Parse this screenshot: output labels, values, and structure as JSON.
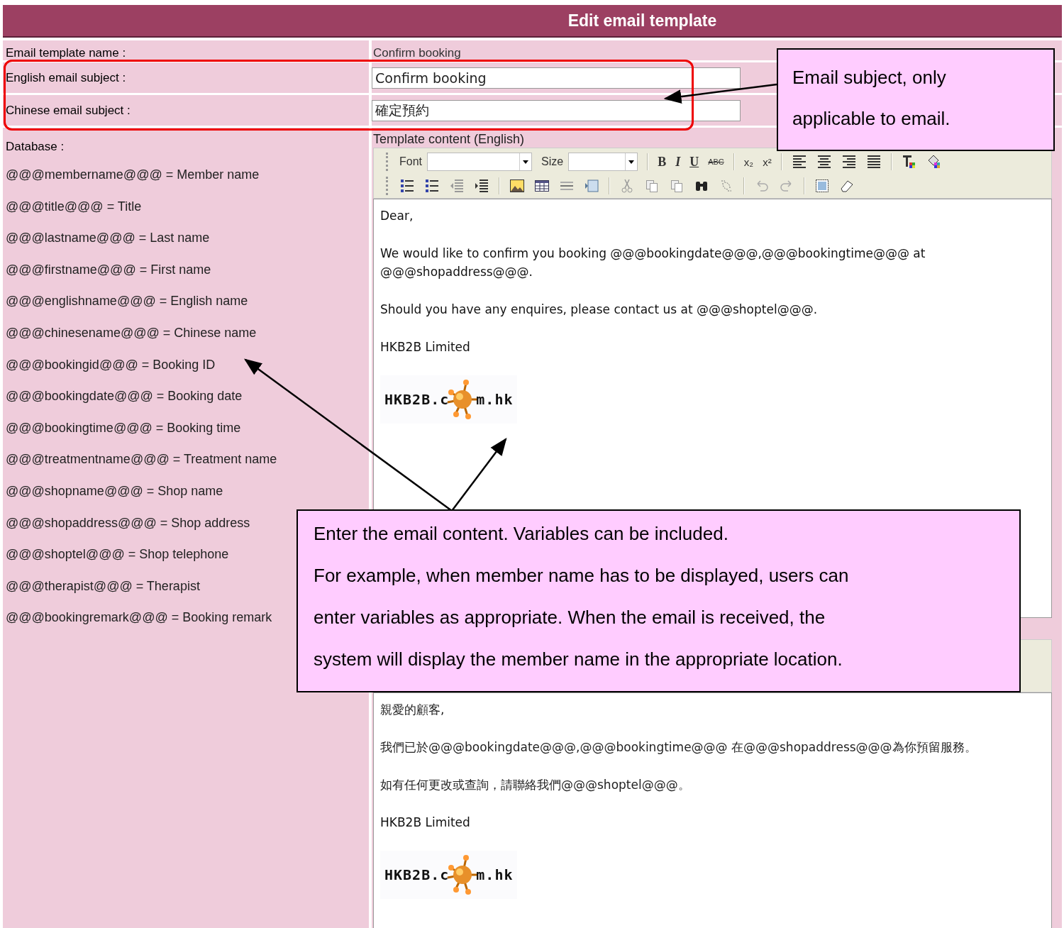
{
  "header": {
    "title": "Edit email template"
  },
  "fields": [
    {
      "label": "Email template name :",
      "value": "Confirm booking",
      "kind": "text"
    },
    {
      "label": "English email subject :",
      "value": "Confirm booking",
      "kind": "input"
    },
    {
      "label": "Chinese email subject :",
      "value": "確定預約",
      "kind": "input"
    }
  ],
  "database": {
    "title": "Database :",
    "items": [
      "@@@membername@@@ = Member name",
      "@@@title@@@ = Title",
      "@@@lastname@@@ = Last name",
      "@@@firstname@@@ = First name",
      "@@@englishname@@@ = English name",
      "@@@chinesename@@@ = Chinese name",
      "@@@bookingid@@@ = Booking ID",
      "@@@bookingdate@@@ = Booking date",
      "@@@bookingtime@@@ = Booking time",
      "@@@treatmentname@@@ = Treatment name",
      "@@@shopname@@@ = Shop name",
      "@@@shopaddress@@@ = Shop address",
      "@@@shoptel@@@ = Shop telephone",
      "@@@therapist@@@ = Therapist",
      "@@@bookingremark@@@ = Booking remark"
    ]
  },
  "editors": [
    {
      "label": "Template content (English)",
      "toolbar": {
        "font_label": "Font",
        "size_label": "Size",
        "format_buttons": [
          "B",
          "I",
          "U",
          "ABC",
          "x₂",
          "x²"
        ]
      },
      "kind": "english",
      "paragraphs": [
        {
          "kind": "body",
          "text": "Dear,"
        },
        {
          "kind": "body",
          "text": "We would like to confirm you booking @@@bookingdate@@@,@@@bookingtime@@@ at @@@shopaddress@@@."
        },
        {
          "kind": "body",
          "text": "Should you have any enquires, please contact us at @@@shoptel@@@."
        },
        {
          "kind": "signature",
          "text": "HKB2B Limited"
        }
      ],
      "logo": [
        "HKB2B.c",
        "m.hk"
      ]
    },
    {
      "kind": "chinese",
      "paragraphs": [
        {
          "kind": "body",
          "text": "親愛的顧客,"
        },
        {
          "kind": "body",
          "text": "我們已於@@@bookingdate@@@,@@@bookingtime@@@ 在@@@shopaddress@@@為你預留服務。"
        },
        {
          "kind": "body",
          "text": "如有任何更改或查詢，請聯絡我們@@@shoptel@@@。"
        },
        {
          "kind": "signature",
          "text": "HKB2B Limited"
        }
      ],
      "logo": [
        "HKB2B.c",
        "m.hk"
      ]
    }
  ],
  "callouts": [
    {
      "kind": "subject",
      "paragraphs": [
        "Email subject, only applicable to email."
      ]
    },
    {
      "kind": "content",
      "paragraphs": [
        "Enter the email content. Variables can be included.",
        "For example, when member name has to be displayed, users can enter variables as appropriate. When the email is received, the system will display the member name in the appropriate location."
      ]
    }
  ]
}
